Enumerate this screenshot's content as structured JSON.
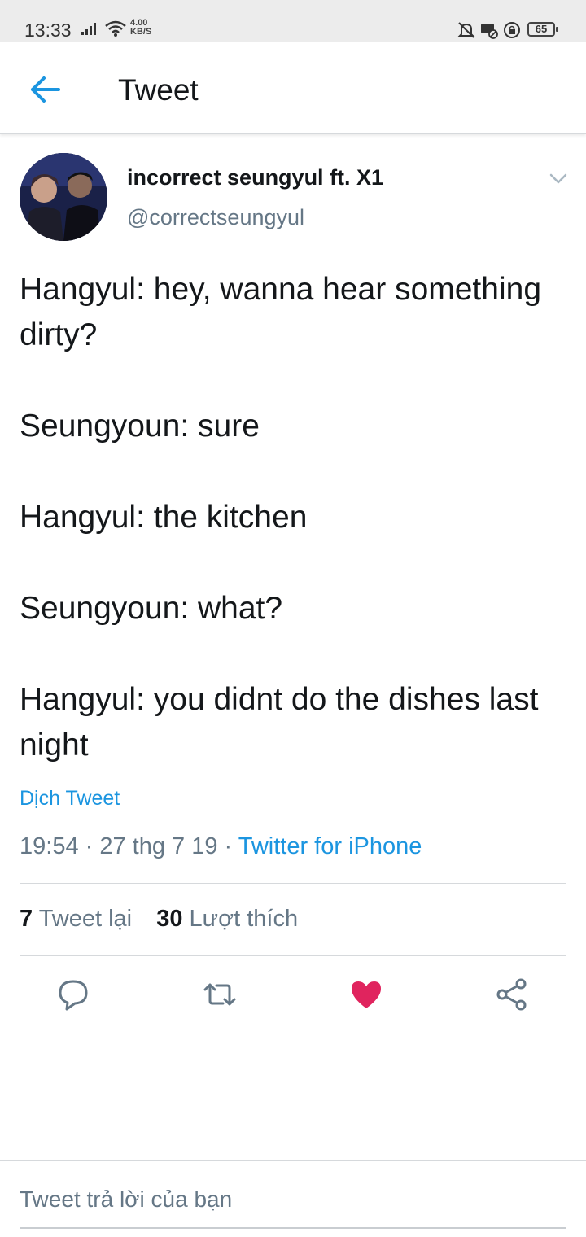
{
  "status_bar": {
    "time": "13:33",
    "speed_value": "4.00",
    "speed_unit": "KB/S",
    "battery": "65"
  },
  "header": {
    "title": "Tweet",
    "back_icon": "arrow-left-icon"
  },
  "tweet": {
    "author_name": "incorrect seungyul ft. X1",
    "author_handle": "@correctseungyul",
    "lines": [
      "Hangyul: hey, wanna hear something dirty?",
      "Seungyoun: sure",
      "Hangyul: the kitchen",
      "Seungyoun: what?",
      "Hangyul: you didnt do the dishes last night"
    ],
    "translate_label": "Dịch Tweet",
    "timestamp": "19:54 · 27 thg 7 19 · ",
    "source": "Twitter for iPhone",
    "retweet_count": "7",
    "retweet_label": "Tweet lại",
    "like_count": "30",
    "like_label": "Lượt thích"
  },
  "actions": [
    "reply-icon",
    "retweet-icon",
    "heart-icon",
    "share-icon"
  ],
  "colors": {
    "accent": "#1b95e0",
    "like": "#e0245e",
    "muted": "#657786"
  },
  "reply": {
    "placeholder": "Tweet trả lời của bạn"
  }
}
